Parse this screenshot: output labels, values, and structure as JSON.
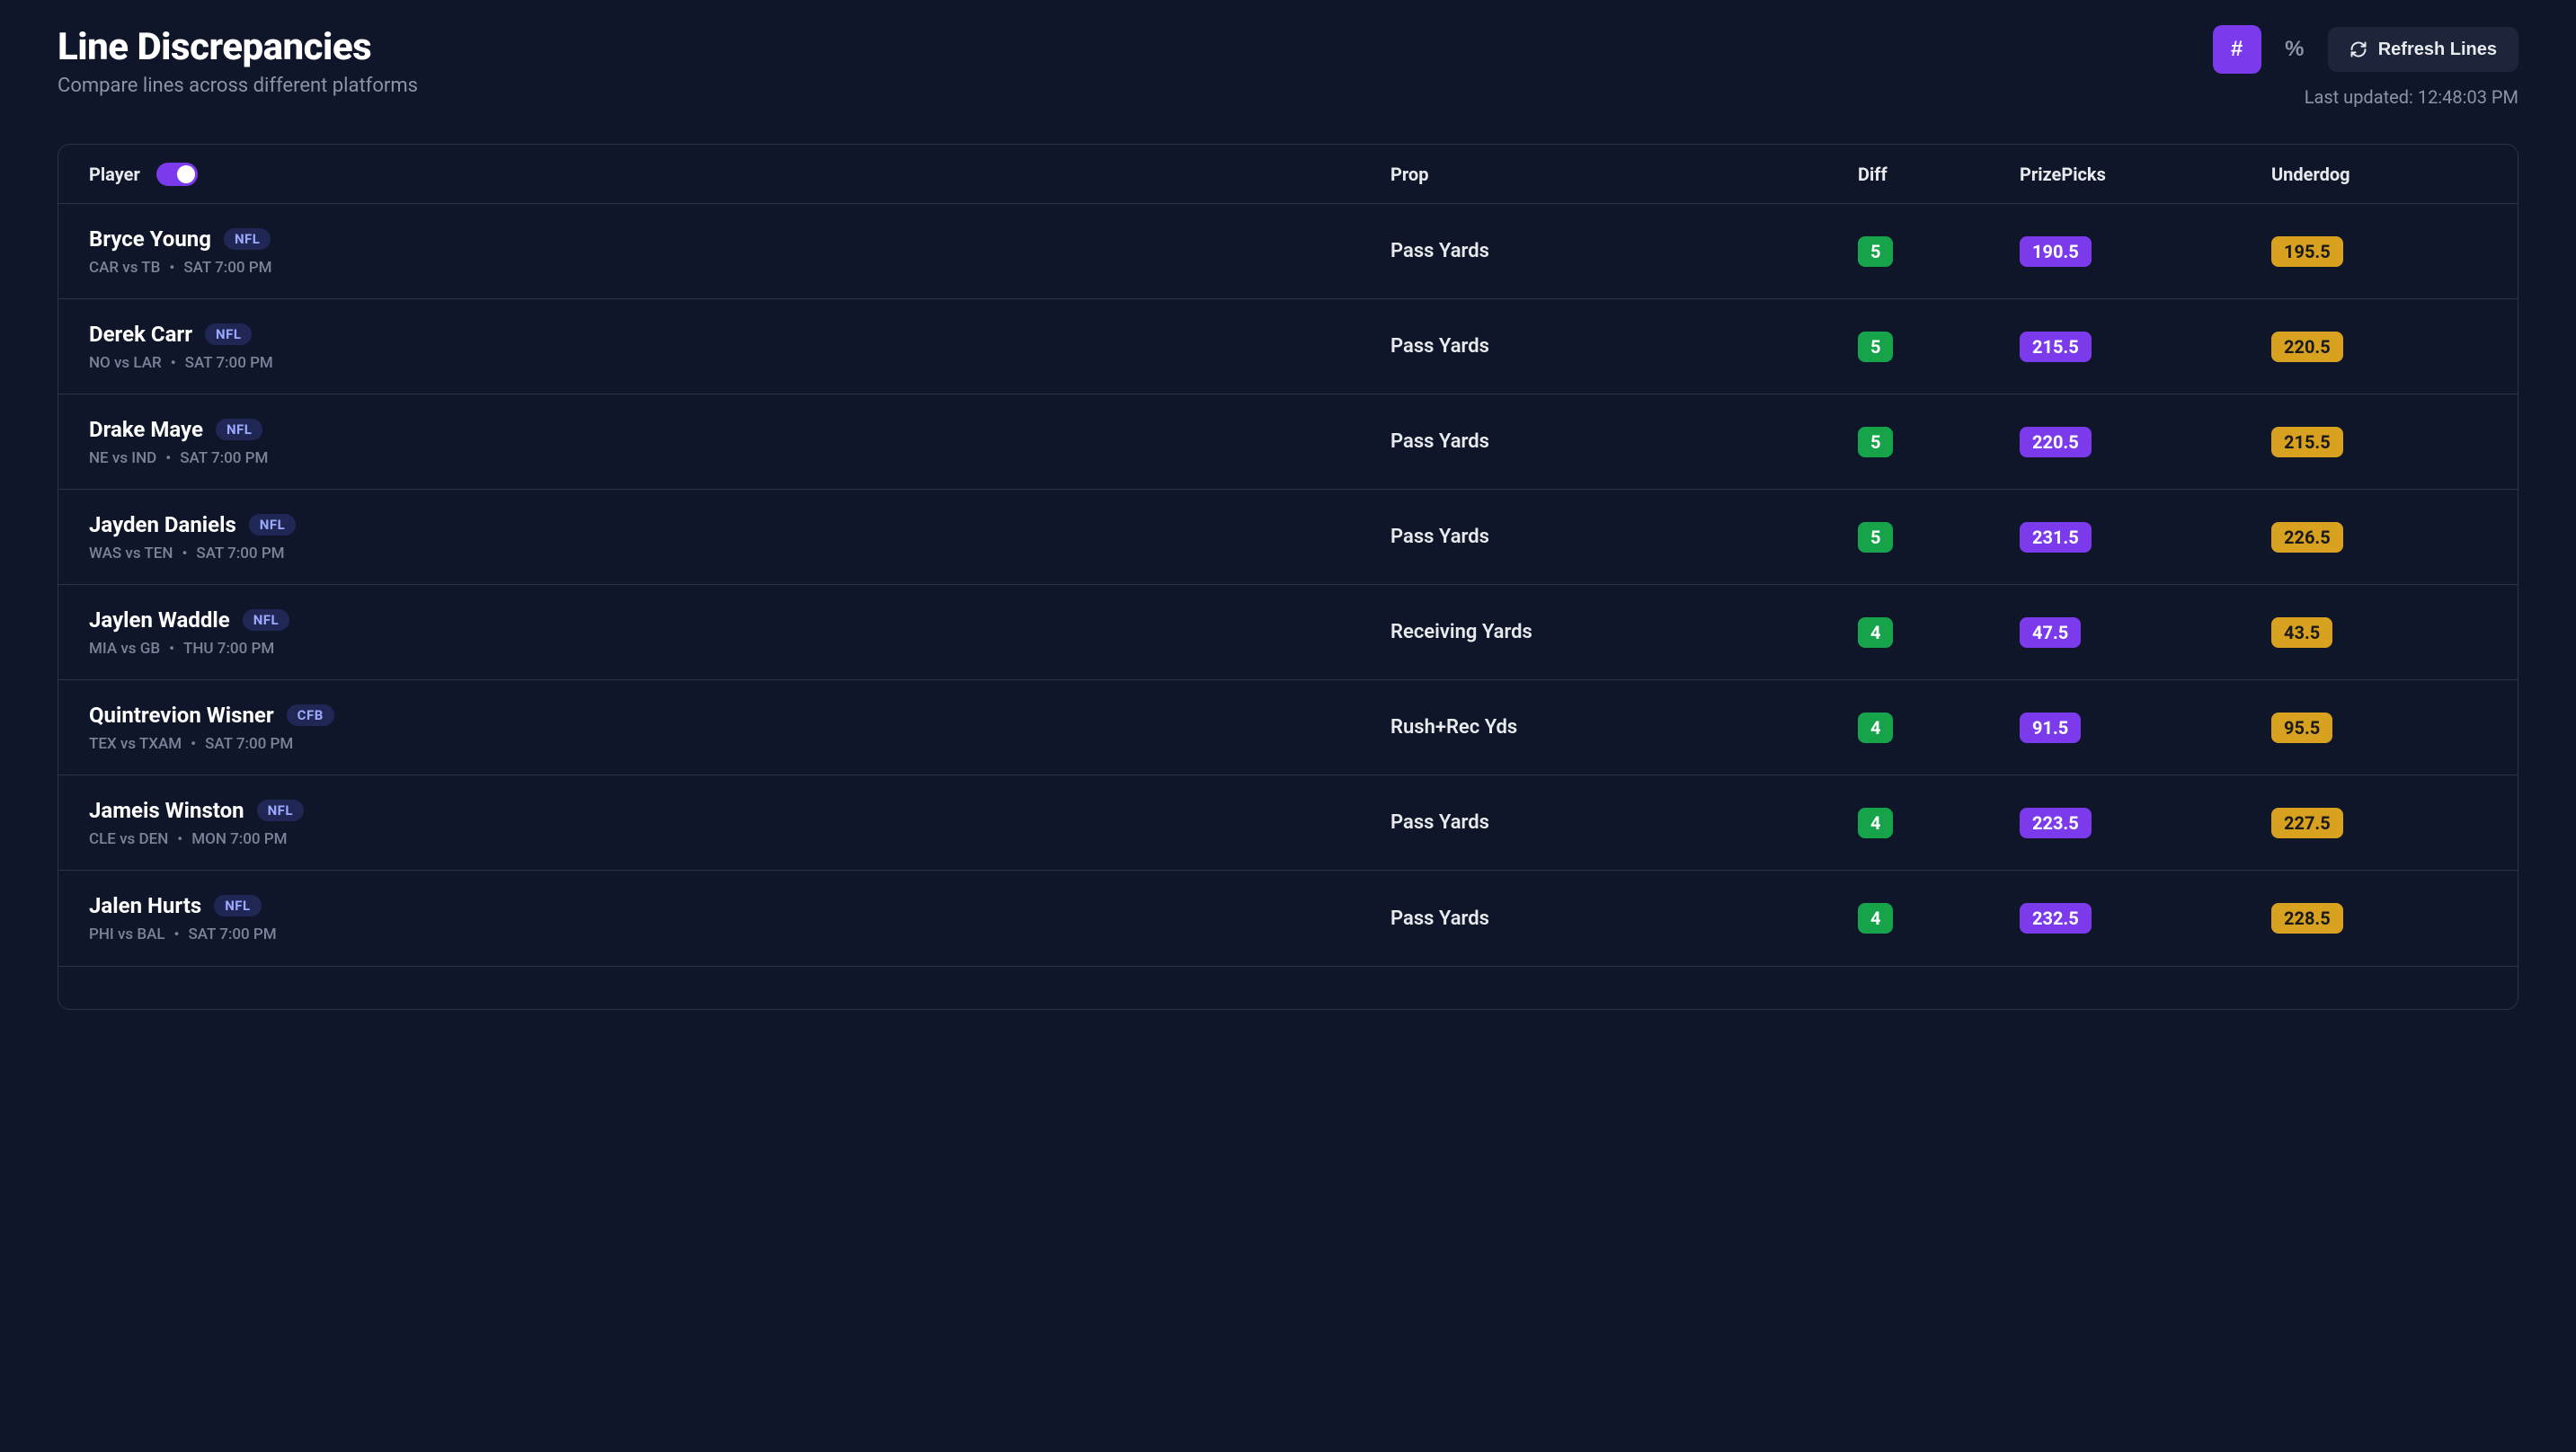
{
  "header": {
    "title": "Line Discrepancies",
    "subtitle": "Compare lines across different platforms",
    "hash_label": "#",
    "percent_label": "%",
    "refresh_label": "Refresh Lines",
    "last_updated": "Last updated: 12:48:03 PM"
  },
  "columns": {
    "player": "Player",
    "prop": "Prop",
    "diff": "Diff",
    "prizepicks": "PrizePicks",
    "underdog": "Underdog"
  },
  "rows": [
    {
      "name": "Bryce Young",
      "league": "NFL",
      "matchup": "CAR vs TB",
      "time": "SAT 7:00 PM",
      "prop": "Pass Yards",
      "diff": "5",
      "prizepicks": "190.5",
      "underdog": "195.5"
    },
    {
      "name": "Derek Carr",
      "league": "NFL",
      "matchup": "NO vs LAR",
      "time": "SAT 7:00 PM",
      "prop": "Pass Yards",
      "diff": "5",
      "prizepicks": "215.5",
      "underdog": "220.5"
    },
    {
      "name": "Drake Maye",
      "league": "NFL",
      "matchup": "NE vs IND",
      "time": "SAT 7:00 PM",
      "prop": "Pass Yards",
      "diff": "5",
      "prizepicks": "220.5",
      "underdog": "215.5"
    },
    {
      "name": "Jayden Daniels",
      "league": "NFL",
      "matchup": "WAS vs TEN",
      "time": "SAT 7:00 PM",
      "prop": "Pass Yards",
      "diff": "5",
      "prizepicks": "231.5",
      "underdog": "226.5"
    },
    {
      "name": "Jaylen Waddle",
      "league": "NFL",
      "matchup": "MIA vs GB",
      "time": "THU 7:00 PM",
      "prop": "Receiving Yards",
      "diff": "4",
      "prizepicks": "47.5",
      "underdog": "43.5"
    },
    {
      "name": "Quintrevion Wisner",
      "league": "CFB",
      "matchup": "TEX vs TXAM",
      "time": "SAT 7:00 PM",
      "prop": "Rush+Rec Yds",
      "diff": "4",
      "prizepicks": "91.5",
      "underdog": "95.5"
    },
    {
      "name": "Jameis Winston",
      "league": "NFL",
      "matchup": "CLE vs DEN",
      "time": "MON 7:00 PM",
      "prop": "Pass Yards",
      "diff": "4",
      "prizepicks": "223.5",
      "underdog": "227.5"
    },
    {
      "name": "Jalen Hurts",
      "league": "NFL",
      "matchup": "PHI vs BAL",
      "time": "SAT 7:00 PM",
      "prop": "Pass Yards",
      "diff": "4",
      "prizepicks": "232.5",
      "underdog": "228.5"
    }
  ]
}
